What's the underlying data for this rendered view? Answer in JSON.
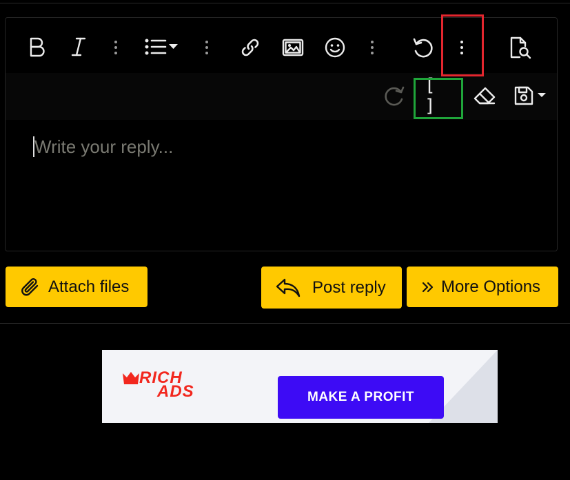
{
  "editor": {
    "placeholder": "Write your reply...",
    "toolbar_row1": [
      "bold-icon",
      "italic-icon",
      "more-vertical-icon",
      "list-icon",
      "more-vertical-icon",
      "link-icon",
      "image-icon",
      "smile-icon",
      "more-vertical-icon",
      "undo-icon",
      "more-vertical-icon",
      "preview-icon"
    ],
    "toolbar_row2": [
      "redo-icon",
      "bbcode-brackets-icon",
      "eraser-icon",
      "save-draft-icon"
    ],
    "bbcode_label": "[ ]"
  },
  "actions": {
    "attach_label": "Attach files",
    "post_label": "Post reply",
    "more_label": "More Options"
  },
  "ad": {
    "logo_line1": "RICH",
    "logo_line2": "ADS",
    "cta_label": "MAKE A PROFIT"
  },
  "colors": {
    "accent": "#ffc900",
    "highlight_red": "#e3262e",
    "highlight_green": "#1fa53a",
    "ad_brand": "#f2271e",
    "ad_cta": "#3d0bf5"
  }
}
